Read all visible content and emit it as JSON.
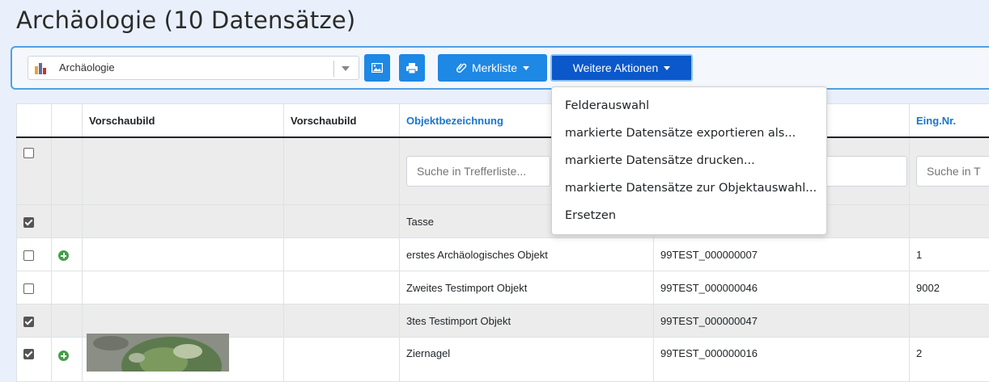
{
  "page": {
    "title": "Archäologie (10 Datensätze)"
  },
  "toolbar": {
    "select_value": "Archäologie",
    "merkliste_label": "Merkliste",
    "more_label": "Weitere Aktionen"
  },
  "colors": {
    "accent": "#1e88e5",
    "accent_active": "#0a58ca",
    "link": "#1976d2",
    "stripe": "#ececec"
  },
  "table": {
    "headers": [
      "",
      "",
      "Vorschaubild",
      "Vorschaubild",
      "Objektbezeichnung",
      "",
      "Eing.Nr."
    ],
    "filter_placeholder": "Suche in Trefferliste...",
    "filter_placeholder_cut": "Suche in T",
    "rows": [
      {
        "checked": true,
        "plus": false,
        "bezeichnung": "Tasse",
        "inv": "",
        "eing": ""
      },
      {
        "checked": false,
        "plus": true,
        "bezeichnung": "erstes Archäologisches Objekt",
        "inv": "99TEST_000000007",
        "eing": "1"
      },
      {
        "checked": false,
        "plus": false,
        "bezeichnung": "Zweites Testimport Objekt",
        "inv": "99TEST_000000046",
        "eing": "9002"
      },
      {
        "checked": true,
        "plus": false,
        "bezeichnung": "3tes Testimport Objekt",
        "inv": "99TEST_000000047",
        "eing": ""
      },
      {
        "checked": true,
        "plus": true,
        "bezeichnung": "Ziernagel",
        "inv": "99TEST_000000016",
        "eing": "2"
      }
    ]
  },
  "dropdown": {
    "items": [
      "Felderauswahl",
      "markierte Datensätze exportieren als...",
      "markierte Datensätze drucken...",
      "markierte Datensätze zur Objektauswahl...",
      "Ersetzen"
    ]
  },
  "icons": [
    "chart-logo-icon",
    "chevron-down-icon",
    "image-icon",
    "printer-icon",
    "paperclip-icon",
    "plus-circle-icon"
  ]
}
